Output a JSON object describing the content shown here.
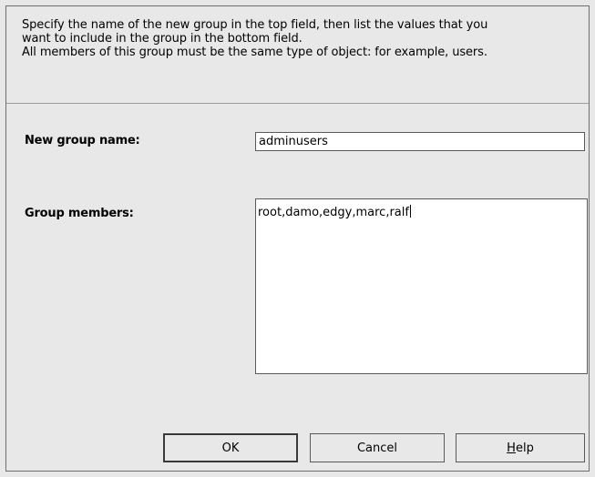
{
  "description": {
    "line1": "Specify the name of the new group in the top field, then list the values that you",
    "line2": "want to include in the group in the bottom field.",
    "line3": "All members of this group must be the same type of object: for example, users."
  },
  "form": {
    "group_name_label": "New group name:",
    "group_name_value": "adminusers",
    "group_members_label": "Group members:",
    "group_members_value": "root,damo,edgy,marc,ralf"
  },
  "buttons": {
    "ok_label": "OK",
    "cancel_label": "Cancel",
    "help_mnemonic": "H",
    "help_rest": "elp"
  }
}
